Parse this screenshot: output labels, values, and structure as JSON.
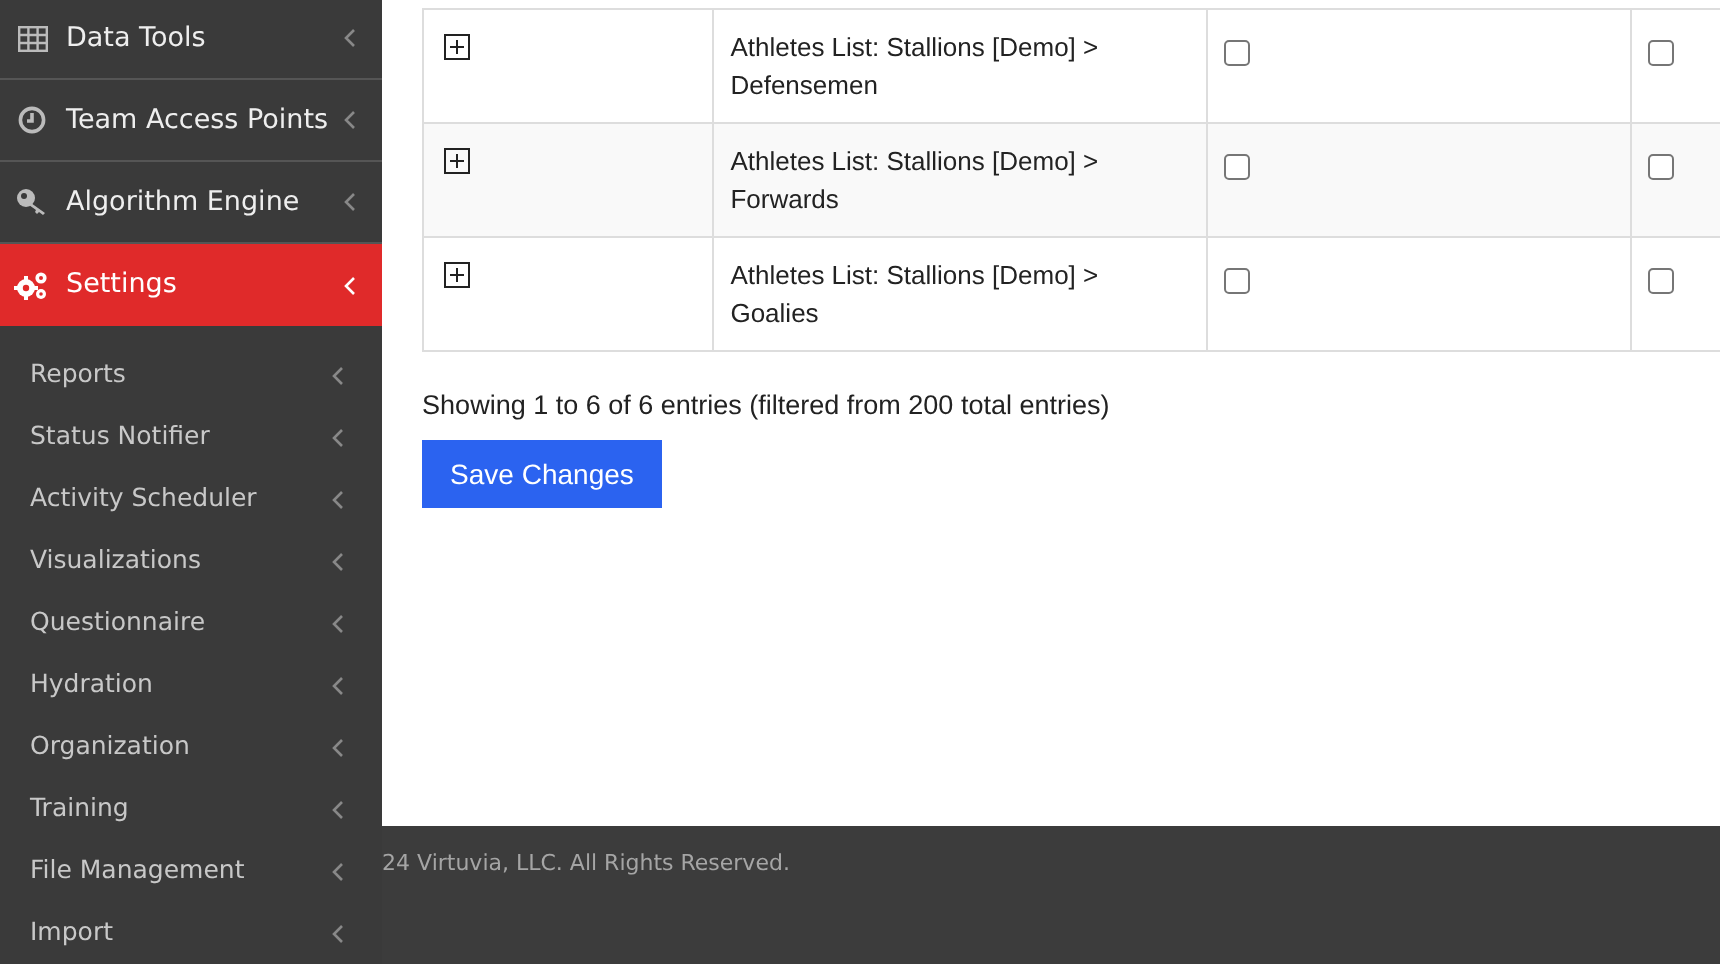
{
  "sidebar": {
    "items": [
      {
        "label": "Data Tools",
        "selected": false
      },
      {
        "label": "Team Access Points",
        "selected": false
      },
      {
        "label": "Algorithm Engine",
        "selected": false
      },
      {
        "label": "Settings",
        "selected": true
      }
    ],
    "subitems": [
      "Reports",
      "Status Notifier",
      "Activity Scheduler",
      "Visualizations",
      "Questionnaire",
      "Hydration",
      "Organization",
      "Training",
      "File Management",
      "Import"
    ]
  },
  "table": {
    "rows": [
      {
        "name": "Athletes List: Stallions [Demo] > Defensemen",
        "column_3_checked": false,
        "column_4_checked": false
      },
      {
        "name": "Athletes List: Stallions [Demo] > Forwards",
        "column_3_checked": false,
        "column_4_checked": false
      },
      {
        "name": "Athletes List: Stallions [Demo] > Goalies",
        "column_3_checked": false,
        "column_4_checked": false
      }
    ]
  },
  "info": "Showing 1 to 6 of 6 entries (filtered from 200 total entries)",
  "save_button": "Save Changes",
  "footer": "24 Virtuvia, LLC. All Rights Reserved."
}
